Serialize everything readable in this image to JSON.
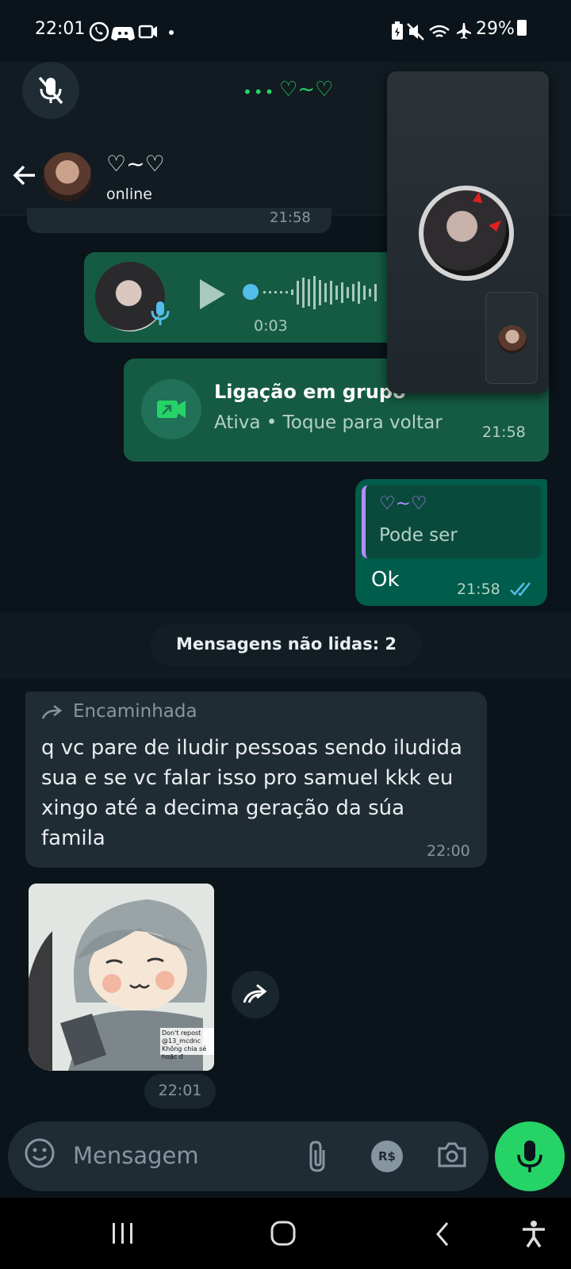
{
  "status_bar": {
    "time": "22:01",
    "battery": "29%"
  },
  "call_banner": {
    "title": "♡~♡",
    "dots": "•••"
  },
  "chat_header": {
    "name": "♡~♡",
    "status": "online"
  },
  "messages": {
    "previous_time": "21:58",
    "voice": {
      "duration": "0:03"
    },
    "group_call": {
      "title": "Ligação em grupo",
      "subtitle": "Ativa • Toque para voltar",
      "time": "21:58"
    },
    "reply": {
      "quoted_name": "♡~♡",
      "quoted_text": "Pode ser",
      "text": "Ok",
      "time": "21:58"
    },
    "unread_banner": "Mensagens não lidas: 2",
    "forwarded": {
      "label": "Encaminhada",
      "text": "q vc pare de iludir pessoas sendo iludida sua  e se vc falar isso pro samuel kkk eu xingo até a decima geração da súa famila",
      "time": "22:00"
    },
    "sticker": {
      "time": "22:01",
      "watermark": "Don't repost @13_mcdnc Không chia sẻ hoặc đ"
    }
  },
  "input": {
    "placeholder": "Mensagem",
    "currency_label": "R$"
  },
  "icons": {
    "status": [
      "whatsapp-icon",
      "discord-icon",
      "video-icon",
      "dot-icon",
      "battery-saver-icon",
      "mute-icon",
      "wifi-icon",
      "airplane-icon",
      "battery-icon"
    ],
    "accent": "#25d366"
  }
}
